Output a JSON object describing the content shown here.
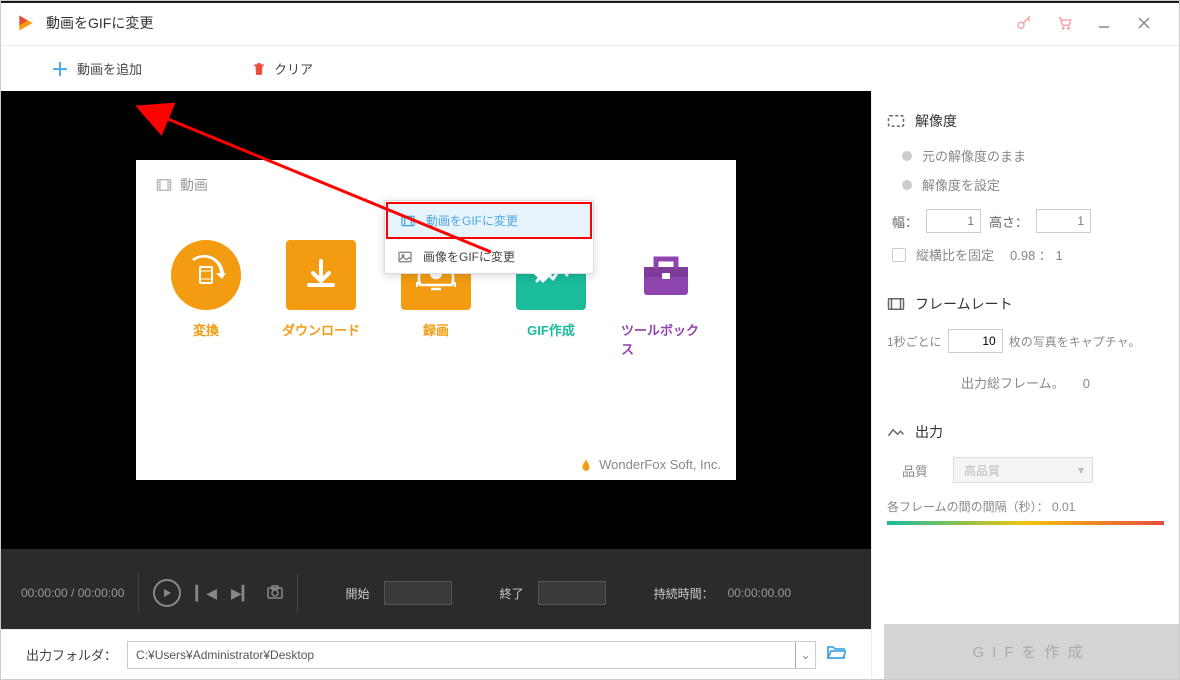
{
  "titlebar": {
    "title": "動画をGIFに変更"
  },
  "toolbar": {
    "add_video": "動画を追加",
    "clear": "クリア"
  },
  "inner": {
    "header": "動画",
    "popup": {
      "item1": "動画をGIFに変更",
      "item2": "画像をGIFに変更"
    },
    "tools": {
      "convert": "変換",
      "download": "ダウンロード",
      "record": "録画",
      "gif": "GIF作成",
      "toolbox": "ツールボックス"
    },
    "brand": "WonderFox Soft, Inc."
  },
  "controls": {
    "time_current": "00:00:00",
    "time_sep": " / ",
    "time_total": "00:00:00",
    "start_label": "開始",
    "end_label": "終了",
    "duration_label": "持続時間：",
    "duration_value": "00:00:00.00"
  },
  "output": {
    "label": "出力フォルダ：",
    "path": "C:¥Users¥Administrator¥Desktop"
  },
  "resolution": {
    "title": "解像度",
    "opt_original": "元の解像度のまま",
    "opt_custom": "解像度を設定",
    "width_label": "幅：",
    "width_value": "1",
    "height_label": "高さ：",
    "height_value": "1",
    "lock_label": "縦横比を固定",
    "ratio": "0.98 ： 1"
  },
  "framerate": {
    "title": "フレームレート",
    "prefix": "1秒ごとに",
    "value": "10",
    "suffix": "枚の写真をキャプチャ。",
    "total_label": "出力総フレーム。",
    "total_value": "0"
  },
  "outputset": {
    "title": "出力",
    "quality_label": "品質",
    "quality_value": "高品質",
    "interval_text": "各フレームの間の間隔（秒）： 0.01"
  },
  "create_btn": "GIFを作成"
}
